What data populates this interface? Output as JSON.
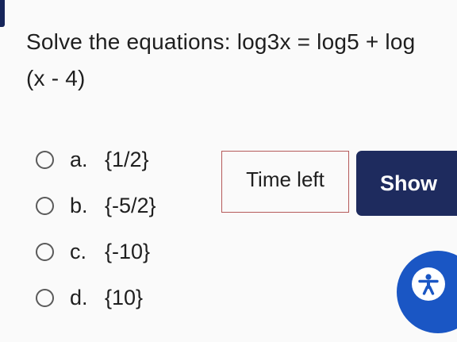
{
  "question": {
    "text": "Solve the equations: log3x = log5 + log (x - 4)"
  },
  "options": [
    {
      "letter": "a.",
      "value": "{1/2}"
    },
    {
      "letter": "b.",
      "value": "{-5/2}"
    },
    {
      "letter": "c.",
      "value": "{-10}"
    },
    {
      "letter": "d.",
      "value": "{10}"
    }
  ],
  "timer": {
    "label": "Time left"
  },
  "show_button": {
    "label": "Show"
  },
  "accessibility": {
    "icon": "accessibility-person-icon"
  },
  "colors": {
    "show_button_bg": "#1e2b5e",
    "accessibility_bg": "#1a56c4",
    "timer_border": "#b55a5a",
    "top_marker": "#16255a"
  }
}
